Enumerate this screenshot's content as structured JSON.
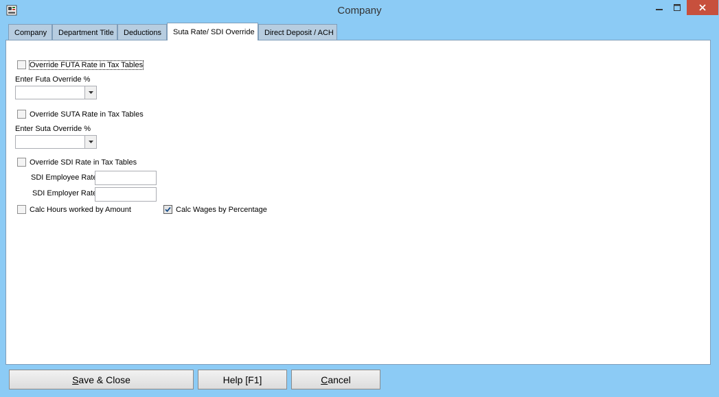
{
  "window": {
    "title": "Company",
    "controls": {
      "minimize": "–",
      "maximize": "□",
      "close": "✕"
    }
  },
  "tabs": [
    {
      "label": "Company"
    },
    {
      "label": "Department Title"
    },
    {
      "label": "Deductions"
    },
    {
      "label": "Suta Rate/ SDI Override",
      "active": true
    },
    {
      "label": "Direct Deposit / ACH"
    }
  ],
  "form": {
    "futa_override": {
      "label": "Override FUTA Rate in Tax Tables",
      "checked": false
    },
    "futa_percent": {
      "label": "Enter Futa Override %",
      "value": ""
    },
    "suta_override": {
      "label": "Override SUTA Rate in Tax Tables",
      "checked": false
    },
    "suta_percent": {
      "label": "Enter Suta Override %",
      "value": ""
    },
    "sdi_override": {
      "label": "Override SDI Rate in Tax Tables",
      "checked": false
    },
    "sdi_employee_rate": {
      "label": "SDI Employee Rate",
      "value": ""
    },
    "sdi_employer_rate": {
      "label": "SDI Employer Rate",
      "value": ""
    },
    "calc_hours": {
      "label": "Calc Hours worked by Amount",
      "checked": false
    },
    "calc_wages": {
      "label": "Calc Wages by Percentage",
      "checked": true
    }
  },
  "footer": {
    "save_close": {
      "mnemonic": "S",
      "rest": "ave & Close"
    },
    "help": {
      "label": "Help [F1]"
    },
    "cancel": {
      "mnemonic": "C",
      "rest": "ancel"
    }
  }
}
